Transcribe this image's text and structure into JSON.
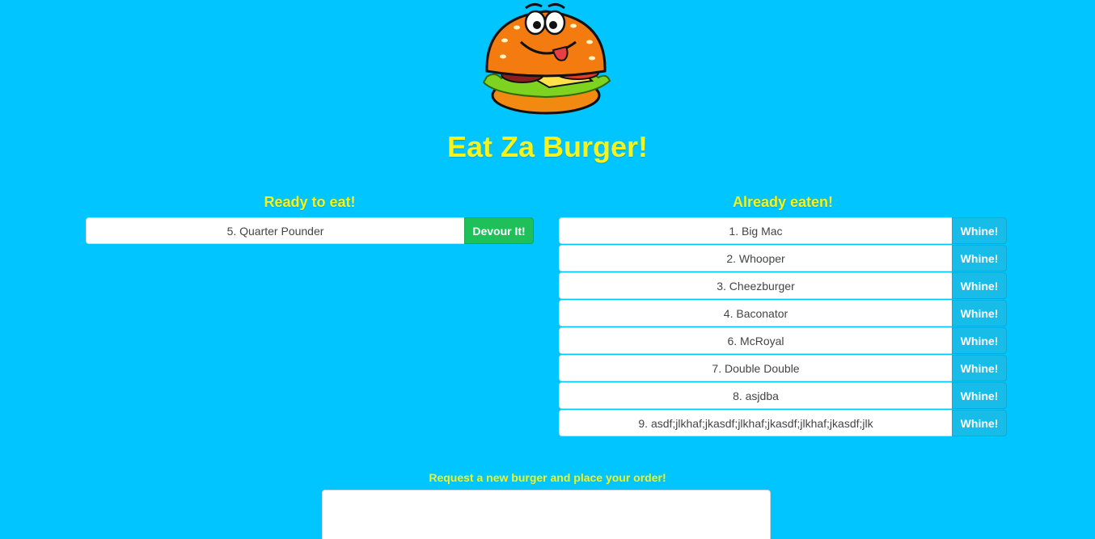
{
  "header": {
    "title": "Eat Za Burger!"
  },
  "ready": {
    "heading": "Ready to eat!",
    "button_label": "Devour It!",
    "items": [
      {
        "label": "5. Quarter Pounder"
      }
    ]
  },
  "eaten": {
    "heading": "Already eaten!",
    "button_label": "Whine!",
    "items": [
      {
        "label": "1. Big Mac"
      },
      {
        "label": "2. Whooper"
      },
      {
        "label": "3. Cheezburger"
      },
      {
        "label": "4. Baconator"
      },
      {
        "label": "6. McRoyal"
      },
      {
        "label": "7. Double Double"
      },
      {
        "label": "8. asjdba"
      },
      {
        "label": "9. asdf;jlkhaf;jkasdf;jlkhaf;jkasdf;jlkhaf;jkasdf;jlk"
      }
    ]
  },
  "request": {
    "label": "Request a new burger and place your order!",
    "value": ""
  },
  "colors": {
    "background": "#00c5ff",
    "title": "#f6f21b",
    "devour_button": "#1fbf5a",
    "whine_button": "#17bde8"
  },
  "icons": {
    "logo": "cartoon-burger-icon"
  }
}
